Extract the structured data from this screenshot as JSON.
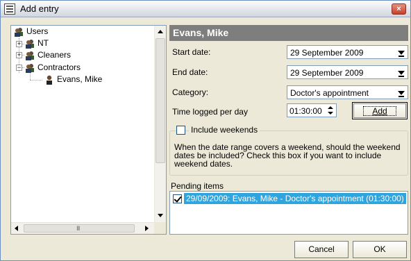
{
  "window": {
    "title": "Add entry",
    "close_label": "×"
  },
  "tree": {
    "root": "Users",
    "groups": [
      "NT",
      "Cleaners",
      "Contractors"
    ],
    "selected_user": "Evans, Mike",
    "hscroll_grip": "III"
  },
  "details": {
    "header": "Evans, Mike",
    "start_date_label": "Start date:",
    "start_date_value": "29 September 2009",
    "end_date_label": "End date:",
    "end_date_value": "29 September 2009",
    "category_label": "Category:",
    "category_value": "Doctor's appointment",
    "time_label": "Time logged per day",
    "time_value": "01:30:00",
    "add_label": "Add"
  },
  "weekends": {
    "label": "Include weekends",
    "checked": false,
    "description": "When the date range covers a weekend, should the weekend dates be included? Check this box if you want to include weekend dates."
  },
  "pending": {
    "label": "Pending items",
    "items": [
      {
        "checked": true,
        "text": "29/09/2009: Evans, Mike - Doctor's appointment (01:30:00)"
      }
    ]
  },
  "footer": {
    "cancel_label": "Cancel",
    "ok_label": "OK"
  },
  "colors": {
    "header_bg": "#7e7e7e",
    "selection": "#2fa4dd",
    "window_bg": "#ece9d8",
    "close_button": "#c7402a"
  }
}
